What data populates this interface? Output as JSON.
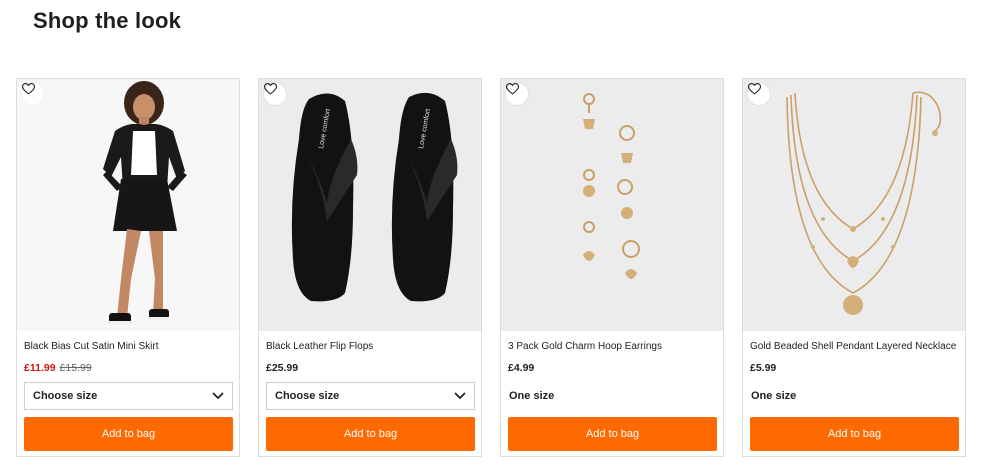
{
  "section": {
    "title": "Shop the look"
  },
  "colors": {
    "accent": "#ff6a00",
    "sale": "#d2150f"
  },
  "products": [
    {
      "name": "Black Bias Cut Satin Mini Skirt",
      "price": "£11.99",
      "was_price": "£15.99",
      "on_sale": true,
      "size_label": "Choose size",
      "size_type": "select",
      "button_label": "Add to bag",
      "icon": "heart-icon"
    },
    {
      "name": "Black Leather Flip Flops",
      "price": "£25.99",
      "size_label": "Choose size",
      "size_type": "select",
      "button_label": "Add to bag",
      "icon": "heart-icon"
    },
    {
      "name": "3 Pack Gold Charm Hoop Earrings",
      "price": "£4.99",
      "size_label": "One size",
      "size_type": "static",
      "button_label": "Add to bag",
      "icon": "heart-icon"
    },
    {
      "name": "Gold Beaded Shell Pendant Layered Necklace",
      "price": "£5.99",
      "size_label": "One size",
      "size_type": "static",
      "button_label": "Add to bag",
      "icon": "heart-icon"
    }
  ]
}
